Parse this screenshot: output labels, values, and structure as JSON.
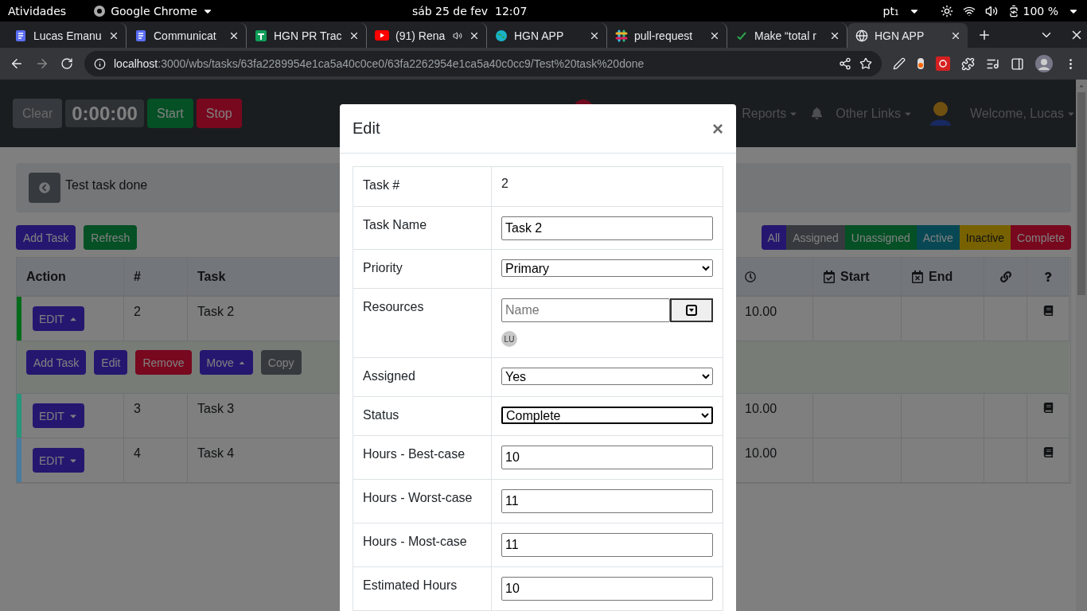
{
  "os_bar": {
    "activities": "Atividades",
    "app": "Google Chrome",
    "clock": "sáb 25 de fev  12:07",
    "keyboard": "pt₁",
    "battery": "100 %"
  },
  "tabs": [
    {
      "title": "Lucas Emanu",
      "kind": "doc",
      "selected": false,
      "audio": false
    },
    {
      "title": "Communicat",
      "kind": "doc",
      "selected": false,
      "audio": false
    },
    {
      "title": "HGN PR Trac",
      "kind": "sheet",
      "selected": false,
      "audio": false
    },
    {
      "title": "(91) Rena",
      "kind": "video",
      "selected": false,
      "audio": true
    },
    {
      "title": "HGN APP",
      "kind": "earth",
      "selected": false,
      "audio": false
    },
    {
      "title": "pull-request",
      "kind": "chat",
      "selected": false,
      "audio": false
    },
    {
      "title": "Make “total r",
      "kind": "check",
      "selected": false,
      "audio": false
    },
    {
      "title": "HGN APP",
      "kind": "globe",
      "selected": true,
      "audio": false
    }
  ],
  "address": {
    "host": "localhost",
    "path": ":3000/wbs/tasks/63fa2289954e1ca5a40c0ce0/63fa2262954e1ca5a40c0cc9/Test%20task%20done"
  },
  "timer": {
    "clear": "Clear",
    "time": "0:00:00",
    "start": "Start",
    "stop": "Stop"
  },
  "nav": {
    "links": [
      "Reports",
      "Other Links"
    ],
    "welcome": "Welcome, Lucas"
  },
  "breadcrumb": "Test task done",
  "actions": [
    {
      "label": "Add Task",
      "kind": "primary"
    },
    {
      "label": "Refresh",
      "kind": "success"
    }
  ],
  "filters": [
    {
      "label": "All",
      "kind": "primary"
    },
    {
      "label": "Assigned",
      "kind": "secondary"
    },
    {
      "label": "Unassigned",
      "kind": "success"
    },
    {
      "label": "Active",
      "kind": "info"
    },
    {
      "label": "Inactive",
      "kind": "warning"
    },
    {
      "label": "Complete",
      "kind": "danger"
    }
  ],
  "table": {
    "columns": [
      {
        "label": "Action",
        "kind": "text"
      },
      {
        "label": "#",
        "kind": "text"
      },
      {
        "label": "Task",
        "kind": "text"
      },
      {
        "kind": "clock"
      },
      {
        "label": "Start",
        "kind": "cal-check"
      },
      {
        "label": "End",
        "kind": "cal-x"
      },
      {
        "kind": "link"
      },
      {
        "kind": "question"
      }
    ],
    "rows": [
      {
        "edit": "EDIT",
        "num": "2",
        "task": "Task 2",
        "hours": "10.00",
        "expanded": true,
        "color": "#006b1a"
      },
      {
        "edit": "EDIT",
        "num": "3",
        "task": "Task 3",
        "hours": "10.00",
        "expanded": false,
        "color": "#28967a"
      },
      {
        "edit": "EDIT",
        "num": "4",
        "task": "Task 4",
        "hours": "10.00",
        "expanded": false,
        "color": "#4a7ca0"
      }
    ],
    "row_actions": [
      {
        "label": "Add Task",
        "kind": "primary",
        "caret": false
      },
      {
        "label": "Edit",
        "kind": "primary",
        "caret": false
      },
      {
        "label": "Remove",
        "kind": "danger",
        "caret": false
      },
      {
        "label": "Move",
        "kind": "primary",
        "caret": true
      },
      {
        "label": "Copy",
        "kind": "secondary",
        "caret": false
      }
    ]
  },
  "modal": {
    "title": "Edit",
    "close": "×",
    "fields": [
      {
        "label": "Task #",
        "kind": "text",
        "value": "2"
      },
      {
        "label": "Task Name",
        "kind": "input",
        "value": "Task 2"
      },
      {
        "label": "Priority",
        "kind": "select",
        "value": "Primary",
        "focused": false
      },
      {
        "label": "Resources",
        "kind": "resources",
        "placeholder": "Name",
        "chip": "LU"
      },
      {
        "label": "Assigned",
        "kind": "select",
        "value": "Yes",
        "focused": false
      },
      {
        "label": "Status",
        "kind": "select",
        "value": "Complete",
        "focused": true
      },
      {
        "label": "Hours - Best-case",
        "kind": "input",
        "value": "10"
      },
      {
        "label": "Hours - Worst-case",
        "kind": "input",
        "value": "11"
      },
      {
        "label": "Hours - Most-case",
        "kind": "input",
        "value": "11"
      },
      {
        "label": "Estimated Hours",
        "kind": "input",
        "value": "10"
      }
    ]
  }
}
